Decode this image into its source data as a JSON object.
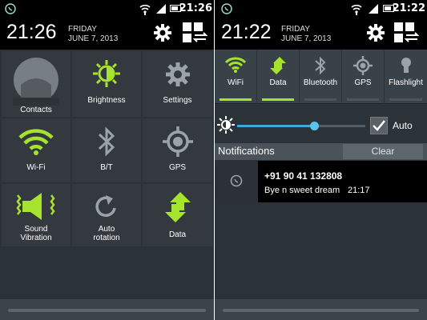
{
  "left_panel": {
    "status_time": "21:26",
    "clock": "21:26",
    "day": "FRIDAY",
    "date": "JUNE 7, 2013",
    "tiles": [
      {
        "label": "Contacts"
      },
      {
        "label": "Brightness"
      },
      {
        "label": "Settings"
      },
      {
        "label": "Wi-Fi"
      },
      {
        "label": "B/T"
      },
      {
        "label": "GPS"
      },
      {
        "label_line1": "Sound",
        "label_line2": "Vibration"
      },
      {
        "label_line1": "Auto",
        "label_line2": "rotation"
      },
      {
        "label": "Data"
      }
    ]
  },
  "right_panel": {
    "status_time": "21:22",
    "clock": "21:22",
    "day": "FRIDAY",
    "date": "JUNE 7, 2013",
    "quick_toggles": [
      {
        "label": "WiFi",
        "active": true
      },
      {
        "label": "Data",
        "active": true
      },
      {
        "label": "Bluetooth",
        "active": false
      },
      {
        "label": "GPS",
        "active": false
      },
      {
        "label": "Flashlight",
        "active": false
      }
    ],
    "brightness": {
      "level": 0.6,
      "auto_label": "Auto",
      "auto_checked": true
    },
    "notifications_label": "Notifications",
    "clear_label": "Clear",
    "notification": {
      "title": "+91 90 41 132808",
      "message": "Bye n sweet dream",
      "time": "21:17"
    }
  },
  "colors": {
    "accent": "#a6e32c",
    "icon_gray": "#9aa3aa",
    "slider": "#3fa9d9"
  }
}
